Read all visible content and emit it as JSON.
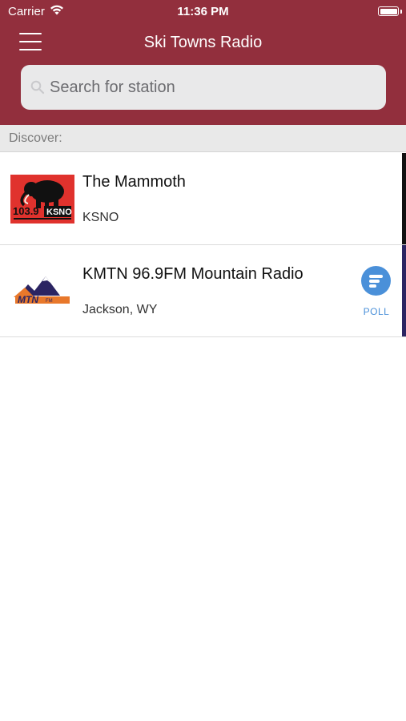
{
  "status_bar": {
    "carrier": "Carrier",
    "time": "11:36 PM",
    "icons": [
      "wifi-icon",
      "battery-icon"
    ]
  },
  "header": {
    "title": "Ski Towns Radio",
    "menu_icon": "hamburger-menu-icon",
    "background_color": "#922f3d"
  },
  "search": {
    "placeholder": "Search for station",
    "value": "",
    "icon": "search-icon"
  },
  "section": {
    "label": "Discover:"
  },
  "stations": [
    {
      "name": "The Mammoth",
      "subtitle": "KSNO",
      "logo": {
        "icon": "mammoth-logo-icon",
        "frequency": "103.9",
        "call_sign": "KSNO"
      },
      "accent_color": "#111111"
    },
    {
      "name": "KMTN 96.9FM Mountain Radio",
      "subtitle": "Jackson, WY",
      "logo": {
        "icon": "mountain-logo-icon",
        "text": "MTN",
        "small_text": "FM"
      },
      "accent_color": "#2b2462",
      "poll": {
        "label": "POLL",
        "icon": "poll-icon",
        "color": "#4a90d9"
      }
    }
  ]
}
